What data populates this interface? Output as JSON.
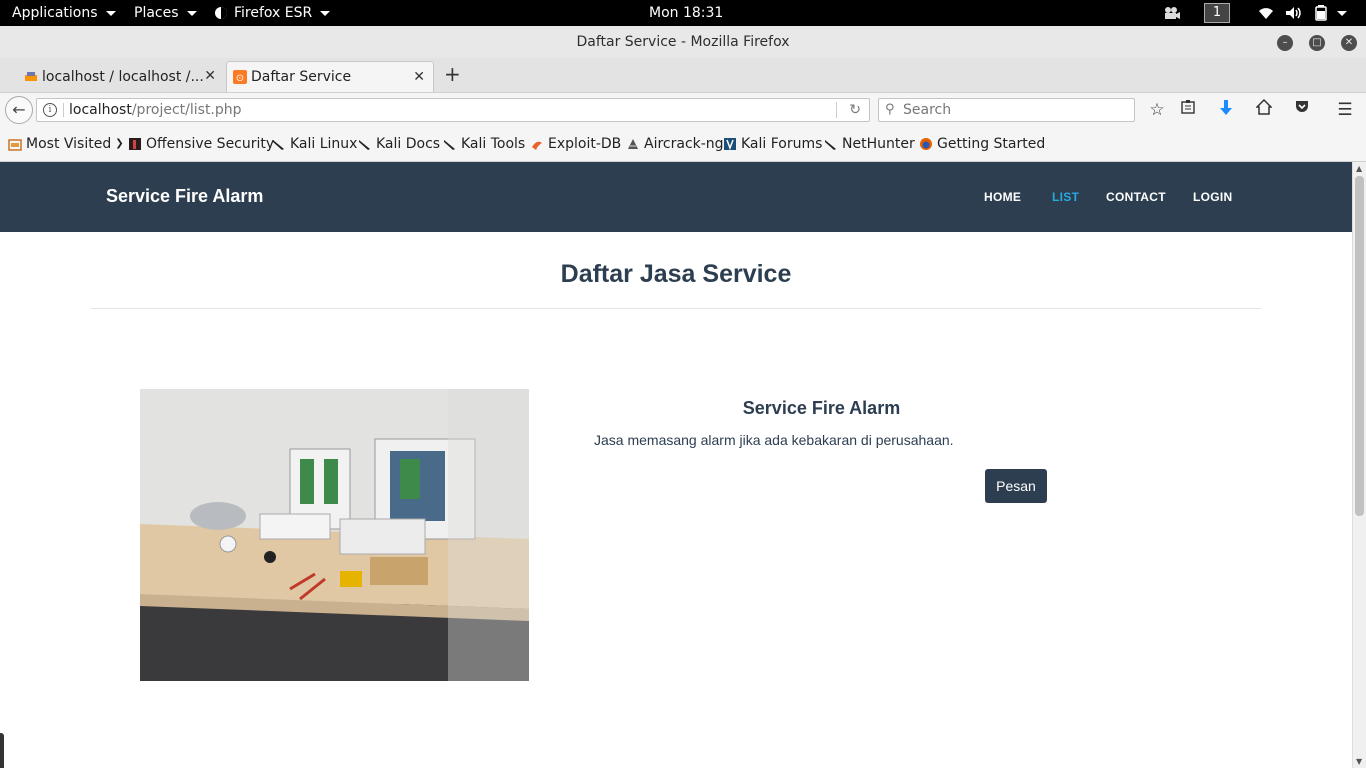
{
  "system_bar": {
    "applications": "Applications",
    "places": "Places",
    "browser_menu": "Firefox ESR",
    "clock": "Mon 18:31",
    "workspace": "1"
  },
  "window": {
    "title": "Daftar Service - Mozilla Firefox"
  },
  "tabs": [
    {
      "label": "localhost / localhost /...",
      "active": false
    },
    {
      "label": "Daftar Service",
      "active": true
    }
  ],
  "navbar": {
    "url_host": "localhost",
    "url_path": "/project/list.php",
    "search_placeholder": "Search"
  },
  "bookmarks": [
    {
      "label": "Most Visited"
    },
    {
      "label": "Offensive Security"
    },
    {
      "label": "Kali Linux"
    },
    {
      "label": "Kali Docs"
    },
    {
      "label": "Kali Tools"
    },
    {
      "label": "Exploit-DB"
    },
    {
      "label": "Aircrack-ng"
    },
    {
      "label": "Kali Forums"
    },
    {
      "label": "NetHunter"
    },
    {
      "label": "Getting Started"
    }
  ],
  "site": {
    "brand": "Service Fire Alarm",
    "menu": [
      {
        "label": "HOME"
      },
      {
        "label": "LIST"
      },
      {
        "label": "CONTACT"
      },
      {
        "label": "LOGIN"
      }
    ],
    "heading": "Daftar Jasa Service",
    "service": {
      "title": "Service Fire Alarm",
      "description": "Jasa memasang alarm jika ada kebakaran di perusahaan.",
      "button": "Pesan"
    }
  },
  "colors": {
    "navbar_bg": "#2c3e50",
    "active_link": "#2aa8e0",
    "button_bg": "#2c3e50"
  }
}
